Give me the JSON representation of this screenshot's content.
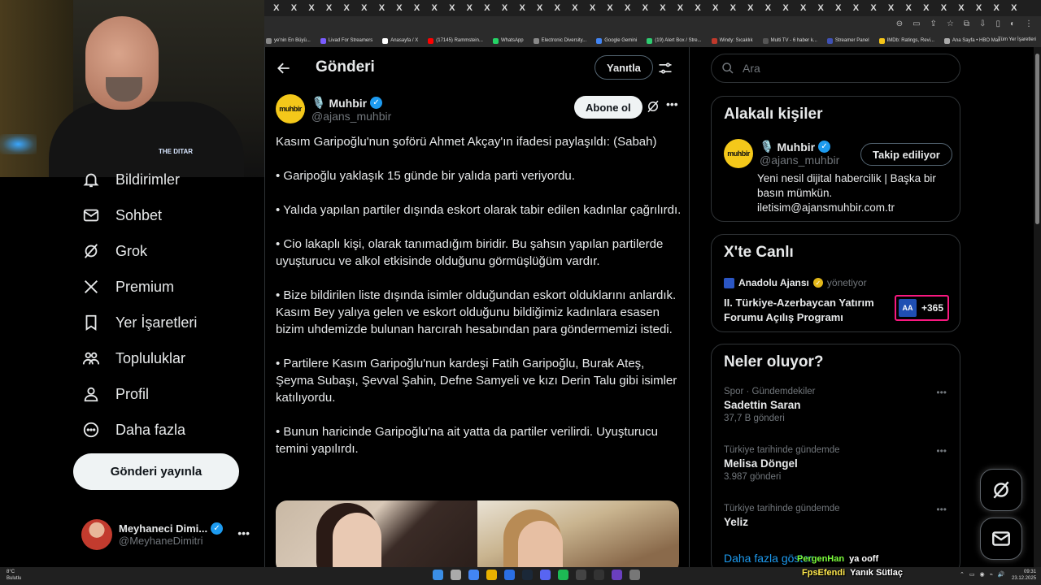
{
  "browser": {
    "tab_glyph": "X",
    "tab_count": 43,
    "bookmarks": [
      {
        "label": "ye'nin En Büyü...",
        "color": "#888"
      },
      {
        "label": "Livad For Streamers",
        "color": "#7a5cff"
      },
      {
        "label": "Anasayfa / X",
        "color": "#fff"
      },
      {
        "label": "(17145) Rammstein...",
        "color": "#ff0000"
      },
      {
        "label": "WhatsApp",
        "color": "#25d366"
      },
      {
        "label": "Electronic Diversity...",
        "color": "#888"
      },
      {
        "label": "Google Gemini",
        "color": "#4285f4"
      },
      {
        "label": "(19) Alert Box / Stre...",
        "color": "#2ecc71"
      },
      {
        "label": "Windy: Sıcaklık",
        "color": "#c0392b"
      },
      {
        "label": "Multi TV - 6 haber k...",
        "color": "#555"
      },
      {
        "label": "Streamer Panel",
        "color": "#3f51b5"
      },
      {
        "label": "IMDb: Ratings, Revi...",
        "color": "#f5c518"
      },
      {
        "label": "Ana Sayfa • HBO Max",
        "color": "#aaa"
      }
    ],
    "all_bookmarks": "Tüm Yer İşaretleri"
  },
  "webcam": {
    "shirt_logo": "THE DITAR"
  },
  "nav": {
    "items": [
      {
        "label": "Bildirimler",
        "icon": "bell-icon"
      },
      {
        "label": "Sohbet",
        "icon": "mail-icon"
      },
      {
        "label": "Grok",
        "icon": "grok-icon"
      },
      {
        "label": "Premium",
        "icon": "x-logo-icon"
      },
      {
        "label": "Yer İşaretleri",
        "icon": "bookmark-icon"
      },
      {
        "label": "Topluluklar",
        "icon": "communities-icon"
      },
      {
        "label": "Profil",
        "icon": "profile-icon"
      },
      {
        "label": "Daha fazla",
        "icon": "more-circle-icon"
      }
    ],
    "post_button": "Gönderi yayınla",
    "account": {
      "name": "Meyhaneci Dimi...",
      "handle": "@MeyhaneDimitri"
    }
  },
  "main": {
    "title": "Gönderi",
    "reply_button": "Yanıtla",
    "author": {
      "logo_text": "muhbir",
      "emoji": "🎙️",
      "name": "Muhbir",
      "handle": "@ajans_muhbir"
    },
    "subscribe_button": "Abone ol",
    "paragraphs": [
      "Kasım Garipoğlu'nun şoförü Ahmet Akçay'ın ifadesi paylaşıldı: (Sabah)",
      "• Garipoğlu yaklaşık 15 günde bir yalıda parti veriyordu.",
      "• Yalıda yapılan partiler dışında eskort olarak tabir edilen kadınlar çağrılırdı.",
      "• Cio lakaplı kişi, olarak tanımadığım biridir. Bu şahsın yapılan partilerde uyuşturucu ve alkol etkisinde olduğunu görmüşlüğüm vardır.",
      "• Bize bildirilen liste dışında isimler olduğundan eskort olduklarını anlardık. Kasım Bey yalıya gelen ve eskort olduğunu bildiğimiz kadınlara esasen bizim uhdemizde bulunan harcırah hesabından para göndermemizi istedi.",
      "• Partilere Kasım Garipoğlu'nun kardeşi Fatih Garipoğlu, Burak Ateş, Şeyma Subaşı, Şevval Şahin, Defne Samyeli ve kızı Derin Talu gibi isimler katılıyordu.",
      "• Bunun haricinde Garipoğlu'na ait yatta da partiler verilirdi. Uyuşturucu temini yapılırdı."
    ]
  },
  "sidebar": {
    "search_placeholder": "Ara",
    "related": {
      "title": "Alakalı kişiler",
      "user": {
        "logo_text": "muhbir",
        "emoji": "🎙️",
        "name": "Muhbir",
        "handle": "@ajans_muhbir"
      },
      "follow_button": "Takip ediliyor",
      "bio": "Yeni nesil dijital habercilik | Başka bir basın mümkün. iletisim@ajansmuhbir.com.tr"
    },
    "live": {
      "title": "X'te Canlı",
      "host": "Anadolu Ajansı",
      "role": "yönetiyor",
      "event": "II. Türkiye-Azerbaycan Yatırım Forumu Açılış Programı",
      "badge_logo": "AA",
      "listeners": "+365"
    },
    "trends": {
      "title": "Neler oluyor?",
      "items": [
        {
          "context": "Spor · Gündemdekiler",
          "title": "Sadettin Saran",
          "count": "37,7 B gönderi"
        },
        {
          "context": "Türkiye tarihinde gündemde",
          "title": "Melisa Döngel",
          "count": "3.987 gönderi"
        },
        {
          "context": "Türkiye tarihinde gündemde",
          "title": "Yeliz",
          "count": ""
        }
      ],
      "show_more": "Daha fazla göster"
    }
  },
  "chat": [
    {
      "user": "PergenHan",
      "message": "ya ooff"
    },
    {
      "user": "FpsEfendi",
      "message": "Yanık Sütlaç"
    }
  ],
  "taskbar": {
    "weather_temp": "8°C",
    "weather_desc": "Bulutlu",
    "time": "09:31",
    "date": "23.12.2025"
  }
}
